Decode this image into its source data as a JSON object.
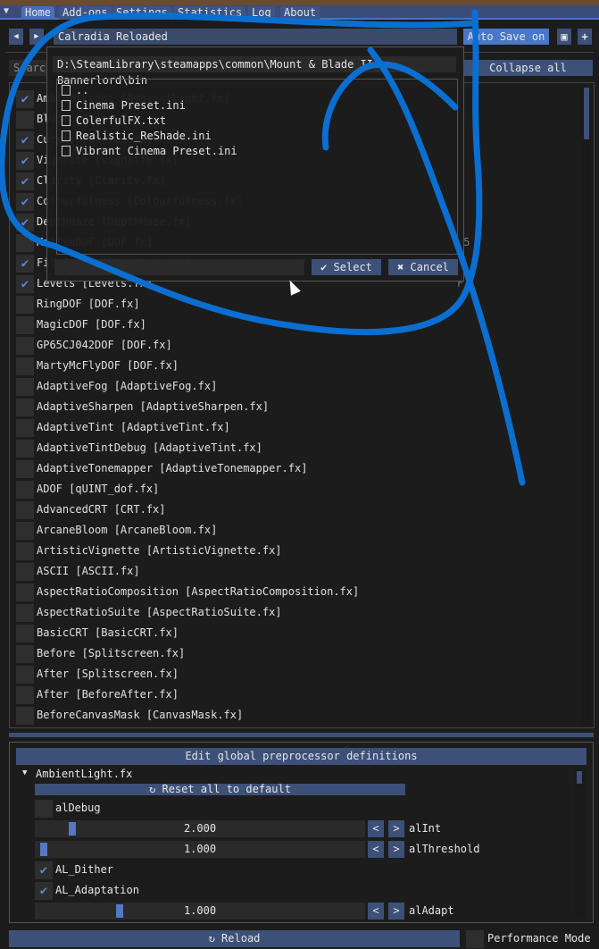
{
  "tabs": [
    "Home",
    "Add-ons",
    "Settings",
    "Statistics",
    "Log",
    "About"
  ],
  "preset": {
    "name": "Calradia Reloaded",
    "auto_save": "Auto Save on",
    "prev": "◀",
    "next": "▶",
    "save_icon": "save-icon",
    "add": "+"
  },
  "search": {
    "placeholder": "Search",
    "collapse_all": "Collapse all"
  },
  "effects": [
    {
      "label": "AmbientLight [AmbientLight.fx]",
      "checked": true
    },
    {
      "label": "Bloom [Bloom.fx]",
      "checked": false
    },
    {
      "label": "Curves [Curves.fx]",
      "checked": true
    },
    {
      "label": "Vignette [Vignette.fx]",
      "checked": true
    },
    {
      "label": "Clarity [Clarity.fx]",
      "checked": true
    },
    {
      "label": "Colourfulness [Colourfulness.fx]",
      "checked": true
    },
    {
      "label": "DepthHaze [DepthHaze.fx]",
      "checked": true
    },
    {
      "label": "MattsoDOF [DOF.fx]",
      "checked": false,
      "key": "F5"
    },
    {
      "label": "FilmGrain [FilmGrain.fx]",
      "checked": true
    },
    {
      "label": "Levels [Levels.fx]",
      "checked": true,
      "key": "F"
    },
    {
      "label": "RingDOF [DOF.fx]",
      "checked": false
    },
    {
      "label": "MagicDOF [DOF.fx]",
      "checked": false
    },
    {
      "label": "GP65CJ042DOF [DOF.fx]",
      "checked": false
    },
    {
      "label": "MartyMcFlyDOF [DOF.fx]",
      "checked": false
    },
    {
      "label": "AdaptiveFog [AdaptiveFog.fx]",
      "checked": false
    },
    {
      "label": "AdaptiveSharpen [AdaptiveSharpen.fx]",
      "checked": false
    },
    {
      "label": "AdaptiveTint [AdaptiveTint.fx]",
      "checked": false
    },
    {
      "label": "AdaptiveTintDebug [AdaptiveTint.fx]",
      "checked": false
    },
    {
      "label": "AdaptiveTonemapper [AdaptiveTonemapper.fx]",
      "checked": false
    },
    {
      "label": "ADOF [qUINT_dof.fx]",
      "checked": false
    },
    {
      "label": "AdvancedCRT [CRT.fx]",
      "checked": false
    },
    {
      "label": "ArcaneBloom [ArcaneBloom.fx]",
      "checked": false
    },
    {
      "label": "ArtisticVignette [ArtisticVignette.fx]",
      "checked": false
    },
    {
      "label": "ASCII [ASCII.fx]",
      "checked": false
    },
    {
      "label": "AspectRatioComposition [AspectRatioComposition.fx]",
      "checked": false
    },
    {
      "label": "AspectRatioSuite [AspectRatioSuite.fx]",
      "checked": false
    },
    {
      "label": "BasicCRT [BasicCRT.fx]",
      "checked": false
    },
    {
      "label": "Before [Splitscreen.fx]",
      "checked": false
    },
    {
      "label": "After [Splitscreen.fx]",
      "checked": false
    },
    {
      "label": "After [BeforeAfter.fx]",
      "checked": false
    },
    {
      "label": "BeforeCanvasMask [CanvasMask.fx]",
      "checked": false
    }
  ],
  "dialog": {
    "path": "D:\\SteamLibrary\\steamapps\\common\\Mount & Blade II Bannerlord\\bin",
    "entries": [
      {
        "name": "..",
        "icon": "folder-icon"
      },
      {
        "name": "Cinema Preset.ini",
        "icon": "file-icon"
      },
      {
        "name": "ColerfulFX.txt",
        "icon": "file-icon"
      },
      {
        "name": "Realistic_ReShade.ini",
        "icon": "file-icon"
      },
      {
        "name": "Vibrant Cinema Preset.ini",
        "icon": "file-icon"
      }
    ],
    "filename": "",
    "select": "✔ Select",
    "cancel": "✖ Cancel"
  },
  "params": {
    "global_defs": "Edit global preprocessor definitions",
    "effect": "AmbientLight.fx",
    "reset": "↻ Reset all to default",
    "items": [
      {
        "type": "checkbox",
        "label": "alDebug",
        "checked": false
      },
      {
        "type": "slider",
        "label": "alInt",
        "value": "2.000",
        "fill": 0.1
      },
      {
        "type": "slider",
        "label": "alThreshold",
        "value": "1.000",
        "fill": 0.01
      },
      {
        "type": "checkbox",
        "label": "AL_Dither",
        "checked": true
      },
      {
        "type": "checkbox",
        "label": "AL_Adaptation",
        "checked": true
      },
      {
        "type": "slider",
        "label": "alAdapt",
        "value": "1.000",
        "fill": 0.25
      }
    ]
  },
  "footer": {
    "reload": "↻ Reload",
    "performance_mode": "Performance Mode",
    "performance_checked": false
  },
  "colors": {
    "accent": "#5c86d8",
    "button": "#3c5078",
    "annotation": "#0a6fd0"
  }
}
